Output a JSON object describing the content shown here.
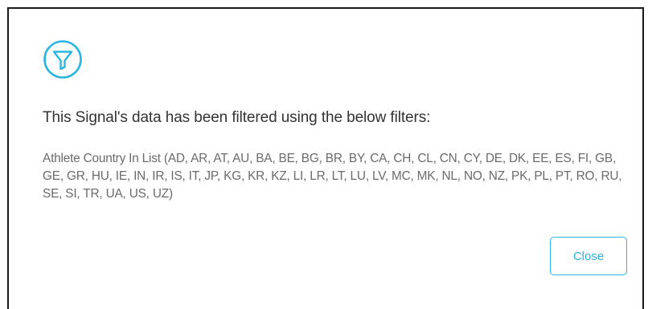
{
  "dialog": {
    "icon": "filter-icon",
    "accent_color": "#2bb5e0",
    "title": "This Signal's data has been filtered using the below filters:",
    "filter_description": "Athlete Country In List (AD, AR, AT, AU, BA, BE, BG, BR, BY, CA, CH, CL, CN, CY, DE, DK, EE, ES, FI, GB, GE, GR, HU, IE, IN, IR, IS, IT, JP, KG, KR, KZ, LI, LR, LT, LU, LV, MC, MK, NL, NO, NZ, PK, PL, PT, RO, RU, SE, SI, TR, UA, US, UZ)",
    "close_label": "Close"
  }
}
